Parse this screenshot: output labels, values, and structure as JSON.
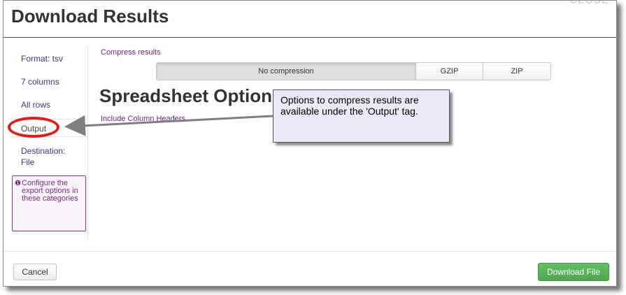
{
  "dialog": {
    "title": "Download Results",
    "close_label": "CLOSE"
  },
  "sidebar": {
    "items": [
      {
        "label": "Format: tsv"
      },
      {
        "label": "7 columns"
      },
      {
        "label": "All rows"
      },
      {
        "label": "Output"
      },
      {
        "label": "Destination: File"
      }
    ],
    "info_text": "Configure the export options in these categories"
  },
  "main": {
    "compress_label": "Compress results",
    "compression_options": [
      "No compression",
      "GZIP",
      "ZIP"
    ],
    "selected_option": "No compression",
    "section_heading": "Spreadsheet Options",
    "include_headers_label": "Include Column Headers"
  },
  "callout": {
    "text": "Options to compress results are available under the 'Output' tag."
  },
  "footer": {
    "cancel_label": "Cancel",
    "download_label": "Download File"
  },
  "colors": {
    "accent": "#6b1f7a",
    "highlight": "#e8191b",
    "download_button": "#5bb75b"
  }
}
